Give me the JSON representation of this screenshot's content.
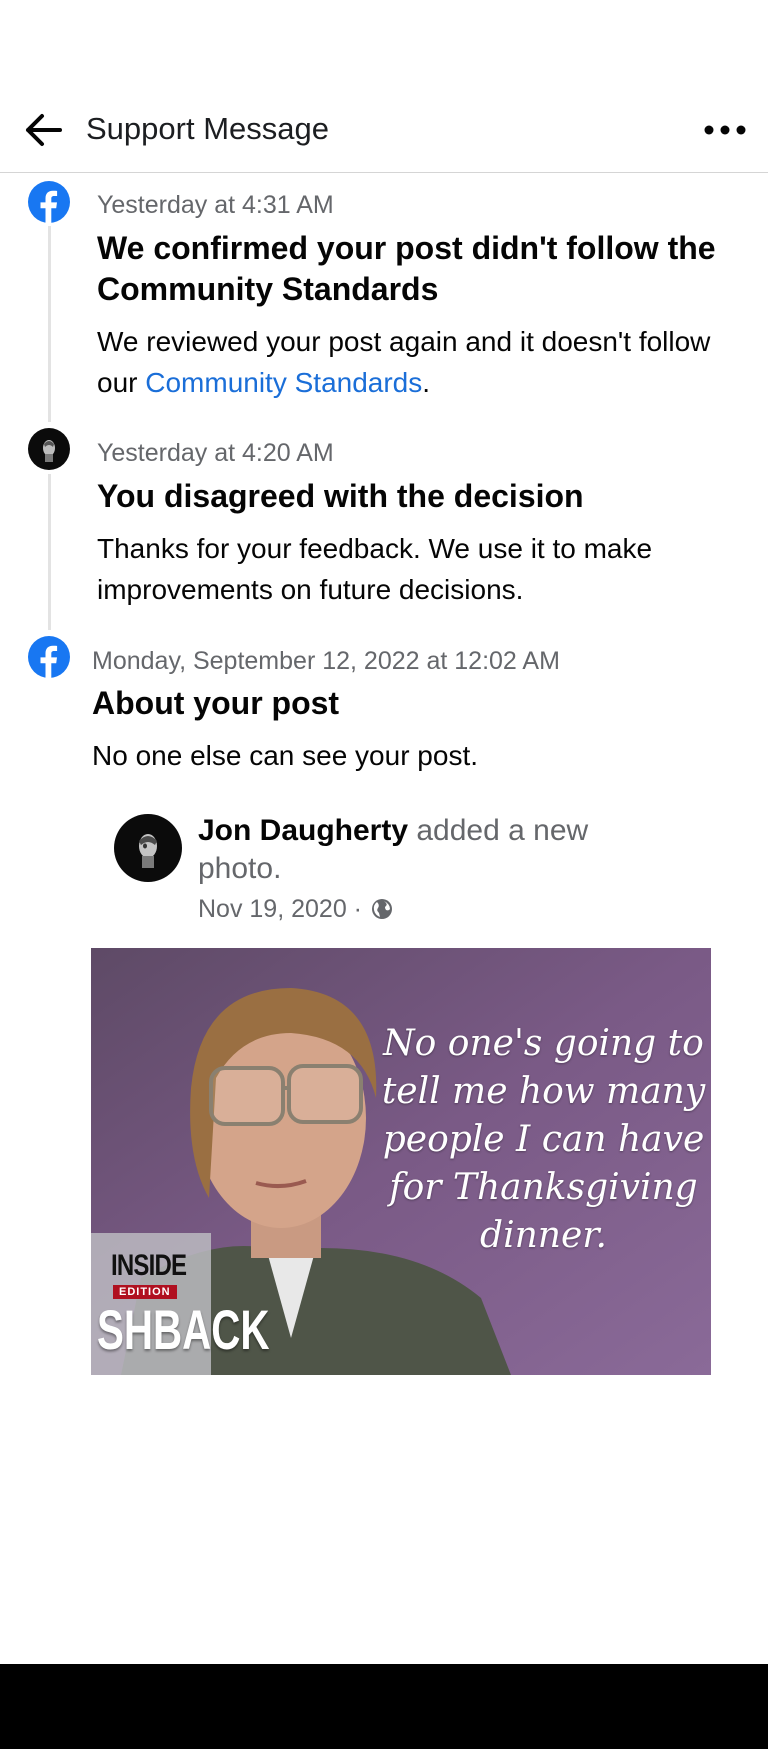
{
  "header": {
    "title": "Support Message",
    "back_icon": "arrow-left-icon",
    "more_icon": "more-horizontal-icon"
  },
  "messages": [
    {
      "icon": "facebook-logo-icon",
      "timestamp": "Yesterday at 4:31 AM",
      "title": "We confirmed your post didn't follow the Community Standards",
      "body_prefix": "We reviewed your post again and it doesn't follow our ",
      "body_link": "Community Standards",
      "body_suffix": "."
    },
    {
      "icon": "user-avatar",
      "timestamp": "Yesterday at 4:20 AM",
      "title": "You disagreed with the decision",
      "body": "Thanks for your feedback. We use it to make improvements on future decisions."
    },
    {
      "icon": "facebook-logo-icon",
      "timestamp": "Monday, September 12, 2022 at 12:02 AM",
      "title": "About your post",
      "body": "No one else can see your post."
    }
  ],
  "post": {
    "author": "Jon Daugherty",
    "action": " added a new photo.",
    "date": "Nov 19, 2020 · ",
    "privacy_icon": "globe-icon",
    "photo": {
      "quote": "No one's going to tell me how many people I can have for Thanksgiving dinner.",
      "logo_inside": "INSIDE",
      "logo_edition": "EDITION",
      "logo_flashback": "SHBACK"
    }
  },
  "colors": {
    "facebook_blue": "#1877f2",
    "link_blue": "#1a6ed8",
    "secondary_text": "#65676b",
    "photo_background": "#7a5a86"
  }
}
